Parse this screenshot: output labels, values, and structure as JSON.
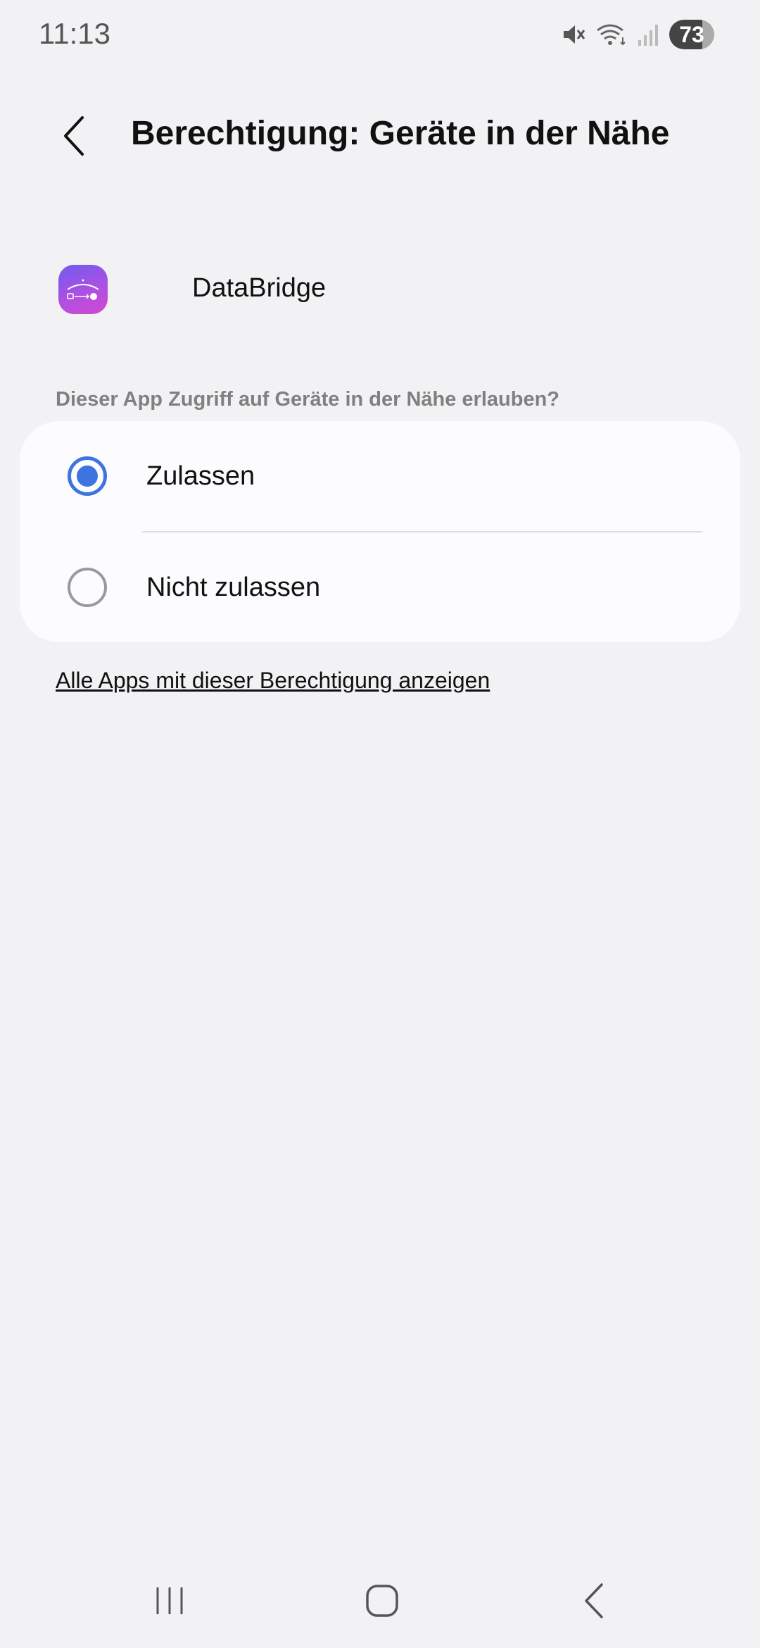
{
  "status_bar": {
    "time": "11:13",
    "battery_level": "73",
    "battery_fraction": 0.73,
    "icons": [
      "mute-icon",
      "wifi-icon",
      "signal-icon",
      "battery-icon"
    ]
  },
  "header": {
    "title": "Berechtigung: Geräte in der Nähe",
    "back_icon": "chevron-left-icon"
  },
  "app": {
    "name": "DataBridge",
    "icon": "databridge-app-icon",
    "icon_colors": [
      "#6f5cf0",
      "#b14fe0",
      "#d04ad0"
    ]
  },
  "permission": {
    "question": "Dieser App Zugriff auf Geräte in der Nähe erlauben?",
    "options": [
      {
        "label": "Zulassen",
        "selected": true
      },
      {
        "label": "Nicht zulassen",
        "selected": false
      }
    ],
    "accent_color": "#3e74e0"
  },
  "link": {
    "label": "Alle Apps mit dieser Berechtigung anzeigen"
  },
  "nav_bar": {
    "buttons": [
      "recent-apps-icon",
      "home-icon",
      "back-icon"
    ]
  }
}
